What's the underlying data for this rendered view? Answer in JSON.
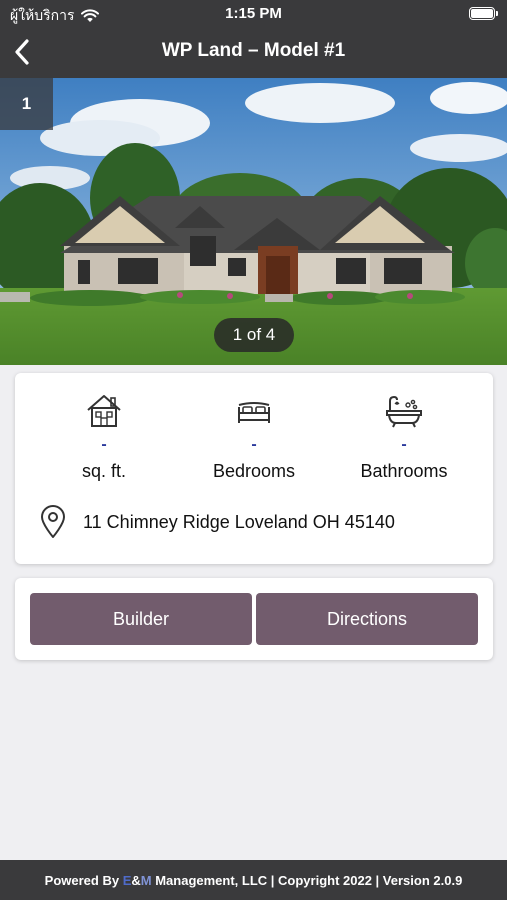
{
  "status_bar": {
    "carrier": "ผู้ให้บริการ",
    "time": "1:15 PM"
  },
  "nav": {
    "title": "WP Land – Model #1",
    "back_icon": "chevron-left-icon"
  },
  "gallery": {
    "current_index": "1",
    "pager_text": "1 of 4"
  },
  "stats": [
    {
      "icon": "house-icon",
      "value": "-",
      "label": "sq. ft."
    },
    {
      "icon": "bed-icon",
      "value": "-",
      "label": "Bedrooms"
    },
    {
      "icon": "bathtub-icon",
      "value": "-",
      "label": "Bathrooms"
    }
  ],
  "address": {
    "icon": "location-pin-icon",
    "text": "11 Chimney Ridge Loveland OH 45140"
  },
  "actions": {
    "builder_label": "Builder",
    "directions_label": "Directions"
  },
  "footer": {
    "prefix": "Powered By ",
    "brand_e": "E",
    "brand_amp": "&",
    "brand_m": "M",
    "suffix": " Management, LLC | Copyright 2022 | Version 2.0.9"
  },
  "colors": {
    "header_bg": "#3a3a3c",
    "button_bg": "#725c6d",
    "value_color": "#2b3a9c",
    "page_bg": "#efeff2"
  }
}
